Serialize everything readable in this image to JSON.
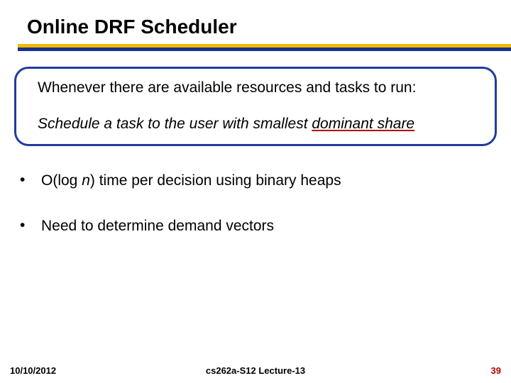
{
  "title": "Online DRF Scheduler",
  "callout": {
    "line1": "Whenever there are available resources and tasks to run:",
    "line2_prefix": "Schedule a task to the user with smallest ",
    "line2_highlight": "dominant share"
  },
  "bullets": [
    {
      "dot": "•",
      "prefix": "O(log ",
      "ital": "n",
      "suffix": ") time per decision using binary heaps"
    },
    {
      "dot": "•",
      "prefix": "Need to determine demand vectors",
      "ital": "",
      "suffix": ""
    }
  ],
  "footer": {
    "date": "10/10/2012",
    "course": "cs262a-S12 Lecture-13",
    "page": "39"
  }
}
